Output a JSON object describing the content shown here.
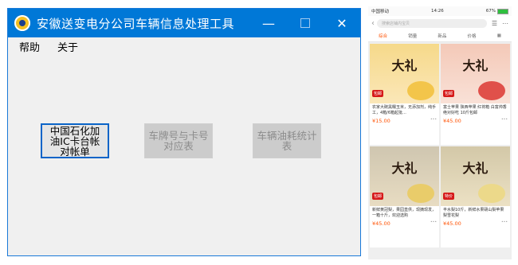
{
  "window": {
    "title": "安徽送变电分公司车辆信息处理工具",
    "minimize": "—",
    "close": "✕"
  },
  "menu": [
    "帮助",
    "关于"
  ],
  "buttons": [
    {
      "label": "中国石化加油IC卡台帐对帐单",
      "state": "active"
    },
    {
      "label": "车牌号与卡号对应表",
      "state": "disabled"
    },
    {
      "label": "车辆油耗统计表",
      "state": "disabled"
    }
  ],
  "phone": {
    "status_left": "中国移动",
    "status_time": "14:26",
    "status_right": "67%",
    "search_placeholder": "搜索店铺内宝贝",
    "tabs": [
      "综合",
      "销量",
      "新品",
      "价格",
      "▦"
    ],
    "cards": [
      {
        "text": "农家大碗黑糯玉米，无添加剂，纯手工，4箱/6箱起批...",
        "price": "¥15.00",
        "brand": "大礼",
        "tag": "包邮"
      },
      {
        "text": "富士苹果 陕西苹果 红将箱 白富帅香 绝对好吃 10斤包邮",
        "price": "¥45.00",
        "brand": "大礼",
        "tag": "包邮"
      },
      {
        "text": "新鲜黄冠梨，果园直供，现摘现发，一箱十斤，欢迎选购",
        "price": "¥45.00",
        "brand": "大礼",
        "tag": "包邮"
      },
      {
        "text": "丰水梨10斤，新鲜水果砀山梨苹果梨雪花梨",
        "price": "¥45.00",
        "brand": "大礼",
        "tag": "特价"
      }
    ]
  },
  "colors": {
    "titlebar": "#0078d7",
    "accent": "#ff5000"
  }
}
